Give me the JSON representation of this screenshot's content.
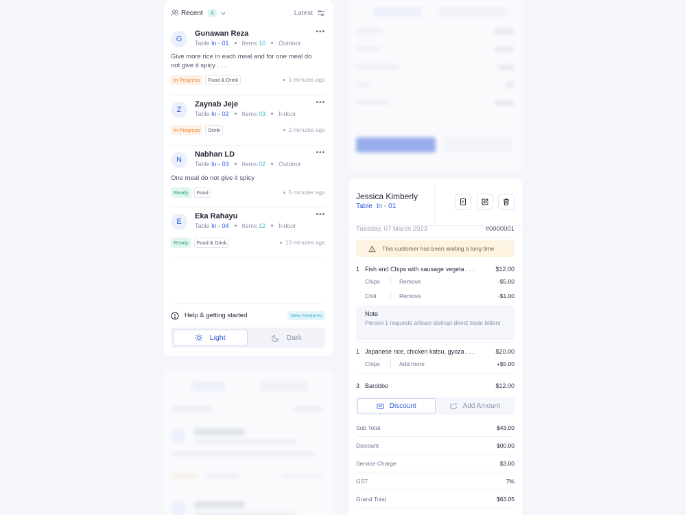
{
  "orders_panel": {
    "recent_label": "Recent",
    "recent_count": "4",
    "sort_label": "Latest",
    "orders": [
      {
        "initial": "G",
        "name": "Gunawan Reza",
        "table_label": "Table",
        "table": "In - 01",
        "items_label": "Items",
        "items": "10",
        "place": "Outdoor",
        "note": "Give more rice in each meal and for one meal do not give it spicy . . .",
        "status": "In Progress",
        "category": "Food & Drink",
        "time": "1 minutes ago"
      },
      {
        "initial": "Z",
        "name": "Zaynab Jeje",
        "table_label": "Table",
        "table": "In - 02",
        "items_label": "Items",
        "items": "03",
        "place": "Indoor",
        "note": "",
        "status": "In Progress",
        "category": "Drink",
        "time": "2 minutes ago"
      },
      {
        "initial": "N",
        "name": "Nabhan LD",
        "table_label": "Table",
        "table": "In - 03",
        "items_label": "Items",
        "items": "02",
        "place": "Outdoor",
        "note": "One meal do not give it spicy",
        "status": "Ready",
        "category": "Food",
        "time": "5 minutes ago"
      },
      {
        "initial": "E",
        "name": "Eka Rahayu",
        "table_label": "Table",
        "table": "In - 04",
        "items_label": "Items",
        "items": "12",
        "place": "Indoor",
        "note": "",
        "status": "Ready",
        "category": "Food & Drink",
        "time": "10 minutes ago"
      }
    ],
    "help_label": "Help & getting started",
    "new_features_label": "New Features",
    "theme_light": "Light",
    "theme_dark": "Dark",
    "active_theme": "Light"
  },
  "order_detail": {
    "customer": "Jessica Kimberly",
    "table_label": "Table",
    "table": "In - 01",
    "date": "Tuesday, 07 March 2023",
    "order_id": "#0000001",
    "warning": "This customer has been waiting a long time",
    "items": [
      {
        "qty": "1",
        "name": "Fish and Chips with sausage vegeta . . .",
        "price": "$12.00"
      },
      {
        "qty": "1",
        "name": "Japanese rice, chicken katsu, gyoza . . .",
        "price": "$20.00"
      },
      {
        "qty": "3",
        "name": "Barobbo",
        "price": "$12.00"
      }
    ],
    "modifiers": [
      {
        "name": "Chips",
        "action": "Remove",
        "price": "-$5.00"
      },
      {
        "name": "Chili",
        "action": "Remove",
        "price": "-$1.00"
      },
      {
        "name": "Chips",
        "action": "Add more",
        "price": "+$5.00"
      }
    ],
    "note_title": "Note",
    "note_text": "Person 1 requests artisan distrupt direct trade bitters",
    "discount_label": "Discount",
    "add_amount_label": "Add Amount",
    "summary": [
      {
        "label": "Sub Total",
        "value": "$43.00"
      },
      {
        "label": "Discount",
        "value": "$00.00"
      },
      {
        "label": "Service Charge",
        "value": "$3.00"
      },
      {
        "label": "GST",
        "value": "7%"
      },
      {
        "label": "Grand Total",
        "value": "$63.05"
      }
    ]
  },
  "colors": {
    "accent": "#2f5ad8",
    "in_progress": "#f0842c",
    "ready": "#24a07c",
    "warning_bg": "#fdf3e1",
    "page_bg": "#f4f6fb"
  },
  "icons": [
    "users-icon",
    "chevron-down-icon",
    "filter-icon",
    "more-icon",
    "info-icon",
    "sun-icon",
    "moon-icon",
    "receipt-icon",
    "edit-icon",
    "trash-icon",
    "warning-icon",
    "ticket-icon",
    "add-card-icon"
  ]
}
